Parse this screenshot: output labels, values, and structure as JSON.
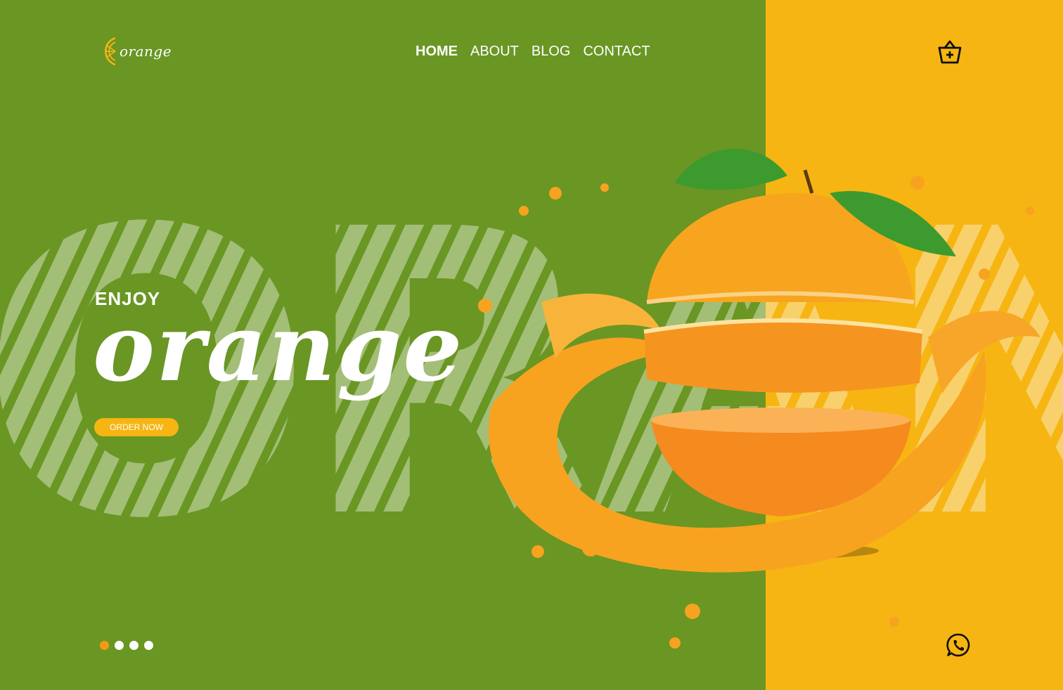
{
  "brand": {
    "logo_text": "orange"
  },
  "nav": {
    "items": [
      {
        "label": "HOME",
        "active": true
      },
      {
        "label": "ABOUT",
        "active": false
      },
      {
        "label": "BLOG",
        "active": false
      },
      {
        "label": "CONTACT",
        "active": false
      }
    ]
  },
  "hero": {
    "kicker": "ENJOY",
    "title": "orange",
    "cta_label": "ORDER NOW",
    "watermark": "ORANGE"
  },
  "carousel": {
    "count": 4,
    "active_index": 0
  },
  "colors": {
    "green": "#6a9624",
    "yellow": "#f6b512",
    "orange_accent": "#f39a12",
    "white": "#ffffff"
  },
  "icons": {
    "logo": "orange-slice-icon",
    "cart": "basket-icon",
    "chat": "whatsapp-icon"
  }
}
